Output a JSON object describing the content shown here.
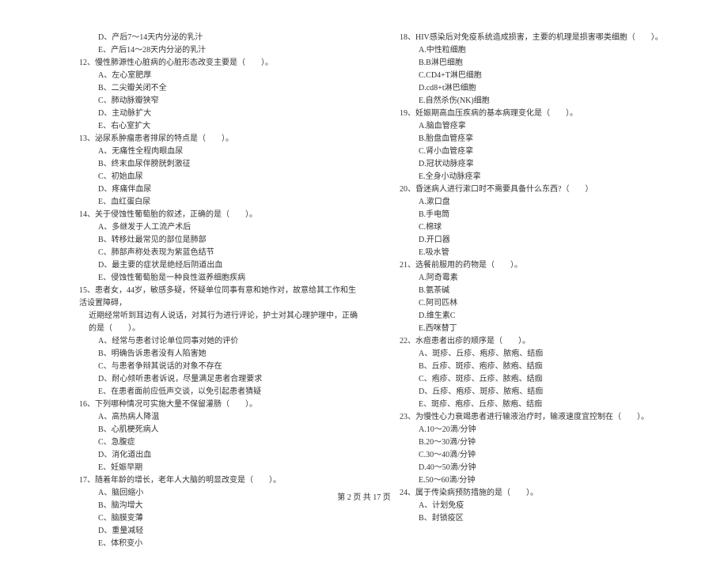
{
  "left_column": {
    "pre_options": [
      "D、产后7～14天内分泌的乳汁",
      "E、产后14～28天内分泌的乳汁"
    ],
    "questions": [
      {
        "num": "12",
        "text": "慢性肺源性心脏病的心脏形态改变主要是（　　）。",
        "options": [
          "左心室肥厚",
          "二尖瓣关闭不全",
          "肺动脉瓣狭窄",
          "主动脉扩大",
          "右心室扩大"
        ]
      },
      {
        "num": "13",
        "text": "泌尿系肿瘤患者排尿的特点是（　　）。",
        "options": [
          "无痛性全程肉眼血尿",
          "终末血尿伴膀胱刺激征",
          "初始血尿",
          "疼痛伴血尿",
          "血红蛋白尿"
        ]
      },
      {
        "num": "14",
        "text": "关于侵蚀性葡萄胎的叙述，正确的是（　　）。",
        "options": [
          "多继发于人工流产术后",
          "转移灶最常见的部位是肺部",
          "肺部声称处表现为紫蓝色结节",
          "最主要的症状是绝经后阴道出血",
          "侵蚀性葡萄胎是一种良性滋养细胞疾病"
        ]
      },
      {
        "num": "15",
        "text": "患者女，44岁，敏感多疑，怀疑单位同事有意和她作对，故意给其工作和生活设置障碍，",
        "continuation": "近期经常听到耳边有人说话，对其行为进行评论，护士对其心理护理中，正确的是（　　）。",
        "options": [
          "经常与患者讨论单位同事对她的评价",
          "明确告诉患者没有人陷害她",
          "与患者争辩其说话的对象不存在",
          "耐心倾听患者诉说，尽量满足患者合理要求",
          "在患者面前应低声交谈，以免引起患者猜疑"
        ]
      },
      {
        "num": "16",
        "text": "下列哪种情况可实施大量不保留灌肠（　　）。",
        "options": [
          "高热病人降温",
          "心肌梗死病人",
          "急腹症",
          "消化道出血",
          "妊娠早期"
        ]
      },
      {
        "num": "17",
        "text": "随着年龄的增长，老年人大脑的明显改变是（　　）。",
        "options": [
          "脑回缩小",
          "脑沟增大",
          "脑膜变薄",
          "重量减轻",
          "体积变小"
        ]
      }
    ]
  },
  "right_column": {
    "questions": [
      {
        "num": "18",
        "text": "HIV感染后对免疫系统造成损害，主要的机理是损害哪类细胞（　　）。",
        "options": [
          "中性粒细胞",
          "B淋巴细胞",
          "CD4+T淋巴细胞",
          "cd8+t淋巴细胞",
          "自然杀伤(NK)细胞"
        ]
      },
      {
        "num": "19",
        "text": "妊娠期高血压疾病的基本病理变化是（　　）。",
        "options": [
          "脑血管痉挛",
          "胎盘血管痉挛",
          "肾小血管痉挛",
          "冠状动脉痉挛",
          "全身小动脉痉挛"
        ]
      },
      {
        "num": "20",
        "text": "昏迷病人进行漱口时不需要具备什么东西?（　　）",
        "options": [
          "漱口盘",
          "手电筒",
          "棉球",
          "开口器",
          "吸水管"
        ]
      },
      {
        "num": "21",
        "text": "选餐前服用的药物是（　　）。",
        "options": [
          "阿奇霉素",
          "氨茶碱",
          "阿司匹林",
          "维生素C",
          "西咪替丁"
        ]
      },
      {
        "num": "22",
        "text": "水痘患者出疹的顺序是（　　）。",
        "options": [
          "斑疹、丘疹、疱疹、脓疱、结痂",
          "丘疹、斑疹、疱疹、脓疱、结痂",
          "疱疹、斑疹、丘疹、脓疱、结痂",
          "丘疹、疱疹、斑疹、脓疱、结痂",
          "斑疹、疱疹、丘疹、脓疱、结痂"
        ]
      },
      {
        "num": "23",
        "text": "为慢性心力衰竭患者进行输液治疗时，输液速度宜控制在（　　）。",
        "options": [
          "10～20滴/分钟",
          "20～30滴/分钟",
          "30～40滴/分钟",
          "40～50滴/分钟",
          "50～60滴/分钟"
        ]
      },
      {
        "num": "24",
        "text": "属于传染病预防措施的是（　　）。",
        "options": [
          "计划免疫",
          "封锁疫区"
        ]
      }
    ]
  },
  "option_letters": [
    "A",
    "B",
    "C",
    "D",
    "E"
  ],
  "footer": "第 2 页 共 17 页"
}
